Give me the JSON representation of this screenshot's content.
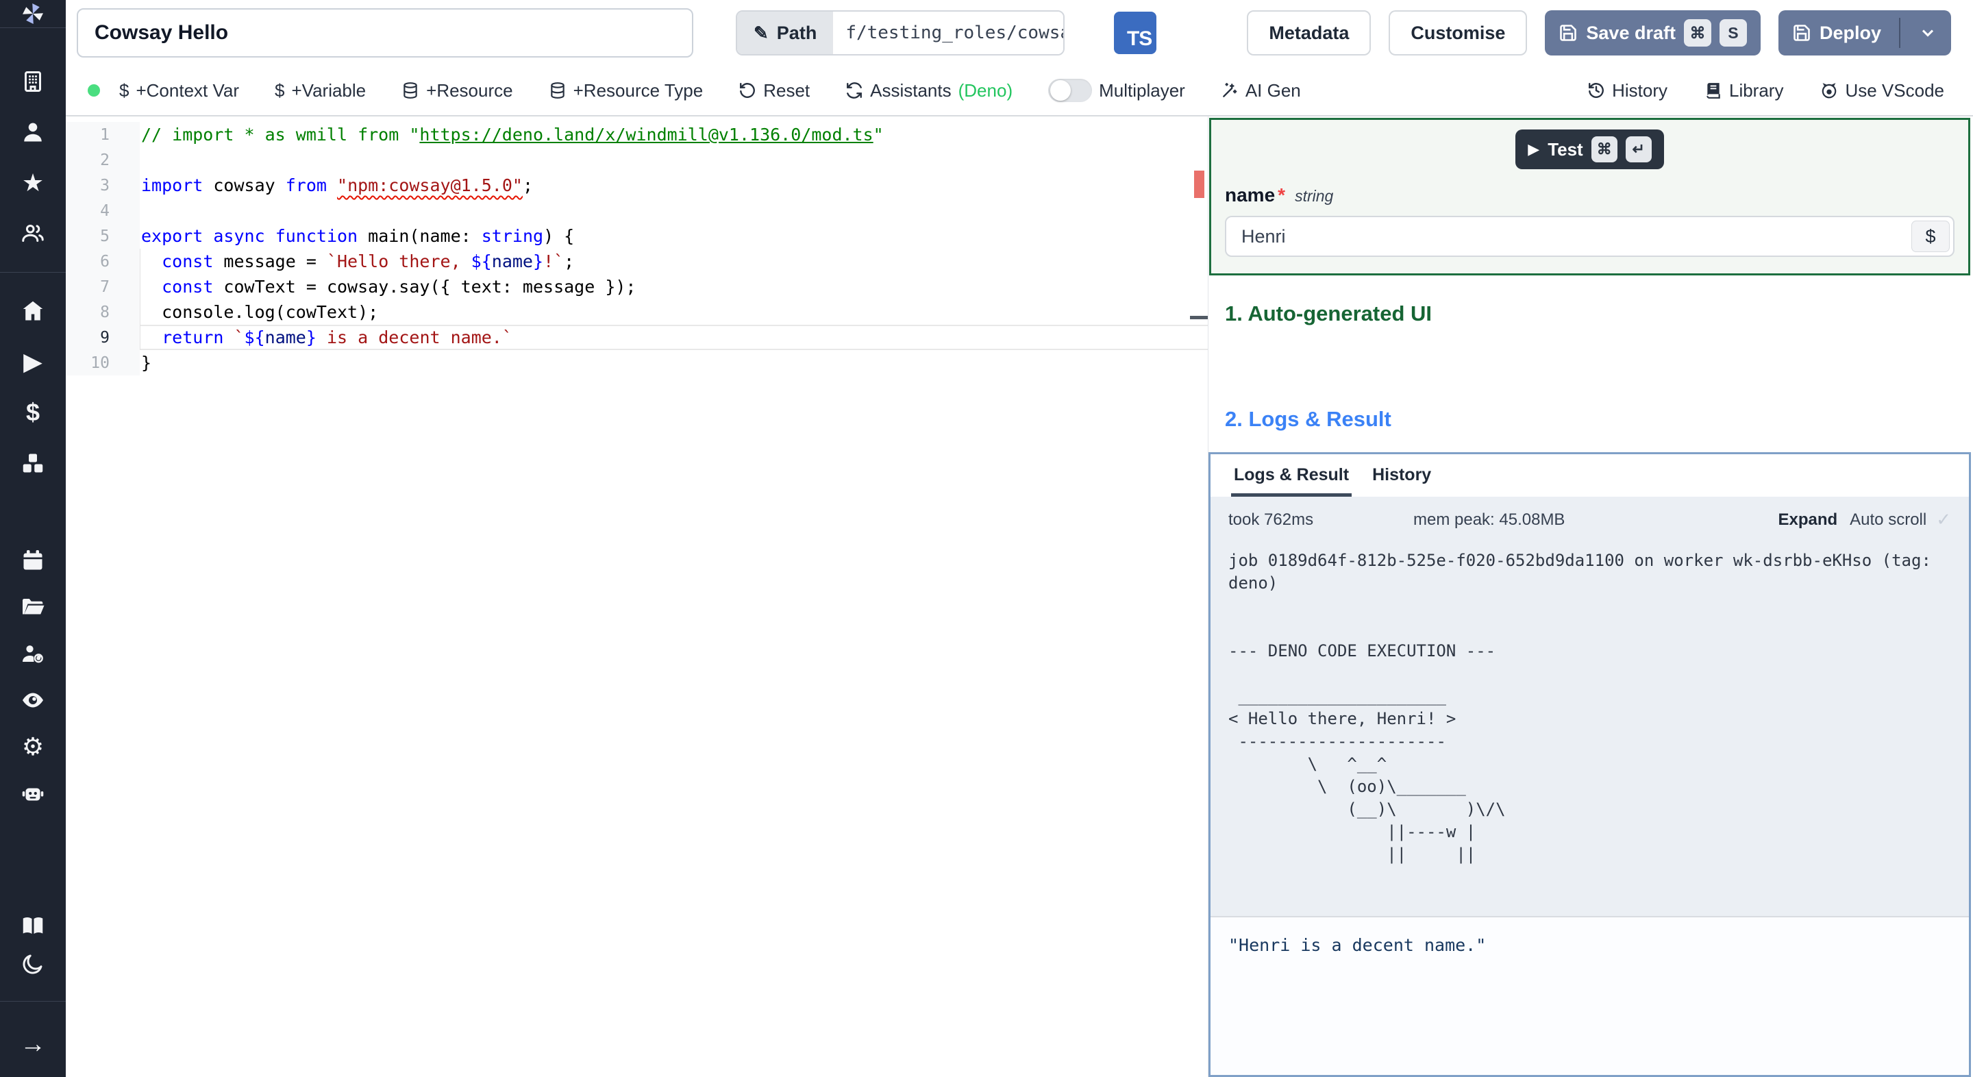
{
  "topbar": {
    "title_value": "Cowsay Hello",
    "path_label": "Path",
    "path_value": "f/testing_roles/cowsa",
    "lang_badge": "TS",
    "metadata_label": "Metadata",
    "customise_label": "Customise",
    "save_draft_label": "Save draft",
    "save_kbd_mod": "⌘",
    "save_kbd_key": "S",
    "deploy_label": "Deploy"
  },
  "toolbar": {
    "status_dot_color": "#4ade80",
    "context_var": "+Context Var",
    "variable": "+Variable",
    "resource": "+Resource",
    "resource_type": "+Resource Type",
    "reset": "Reset",
    "assistants": "Assistants",
    "assistants_lang": "(Deno)",
    "multiplayer": "Multiplayer",
    "ai_gen": "AI Gen",
    "history": "History",
    "library": "Library",
    "use_vscode": "Use VScode",
    "dollar": "$"
  },
  "sidebar": {
    "icons": [
      "windmill-logo",
      "building",
      "user",
      "star",
      "users",
      "home",
      "play",
      "dollar",
      "boxes",
      "calendar",
      "folder-open",
      "user-cog",
      "eye",
      "gear",
      "robot",
      "book-open",
      "moon",
      "arrow-right"
    ]
  },
  "editor": {
    "lines": [
      {
        "n": "1",
        "tokens": [
          [
            "c",
            "// import * as wmill from \""
          ],
          [
            "cl",
            "https://deno.land/x/windmill@v1.136.0/mod.ts"
          ],
          [
            "c",
            "\""
          ]
        ]
      },
      {
        "n": "2",
        "tokens": []
      },
      {
        "n": "3",
        "tokens": [
          [
            "k",
            "import"
          ],
          [
            "p",
            " cowsay "
          ],
          [
            "k",
            "from"
          ],
          [
            "p",
            " "
          ],
          [
            "sq",
            "\"npm:cowsay@1.5.0\""
          ],
          [
            "p",
            ";"
          ]
        ]
      },
      {
        "n": "4",
        "tokens": []
      },
      {
        "n": "5",
        "tokens": [
          [
            "k",
            "export"
          ],
          [
            "p",
            " "
          ],
          [
            "k",
            "async"
          ],
          [
            "p",
            " "
          ],
          [
            "k",
            "function"
          ],
          [
            "p",
            " main(name: "
          ],
          [
            "k",
            "string"
          ],
          [
            "p",
            ") {"
          ]
        ]
      },
      {
        "n": "6",
        "guide": true,
        "tokens": [
          [
            "p",
            "  "
          ],
          [
            "k",
            "const"
          ],
          [
            "p",
            " message = "
          ],
          [
            "s",
            "`Hello there, "
          ],
          [
            "b",
            "${"
          ],
          [
            "v",
            "name"
          ],
          [
            "b",
            "}"
          ],
          [
            "s",
            "!`"
          ],
          [
            "p",
            ";"
          ]
        ]
      },
      {
        "n": "7",
        "guide": true,
        "tokens": [
          [
            "p",
            "  "
          ],
          [
            "k",
            "const"
          ],
          [
            "p",
            " cowText = cowsay.say({ text: message });"
          ]
        ]
      },
      {
        "n": "8",
        "guide": true,
        "tokens": [
          [
            "p",
            "  console.log(cowText);"
          ]
        ]
      },
      {
        "n": "9",
        "guide": true,
        "active": true,
        "tokens": [
          [
            "p",
            "  "
          ],
          [
            "k",
            "return"
          ],
          [
            "p",
            " "
          ],
          [
            "s",
            "`"
          ],
          [
            "b",
            "${"
          ],
          [
            "v",
            "name"
          ],
          [
            "b",
            "}"
          ],
          [
            "s",
            " is a decent name.`"
          ]
        ]
      },
      {
        "n": "10",
        "tokens": [
          [
            "p",
            "}"
          ]
        ]
      }
    ]
  },
  "panel": {
    "test_label": "Test",
    "test_kbd_mod": "⌘",
    "test_kbd_enter": "↵",
    "arg_name": "name",
    "required_mark": "*",
    "arg_type": "string",
    "arg_value": "Henri",
    "dollar_button": "$",
    "section_auto_ui": "1. Auto-generated UI",
    "section_logs": "2. Logs & Result",
    "tab_logs": "Logs & Result",
    "tab_history": "History",
    "took": "took 762ms",
    "mem": "mem peak: 45.08MB",
    "expand": "Expand",
    "autoscroll": "Auto scroll",
    "check": "✓",
    "log_block": "job 0189d64f-812b-525e-f020-652bd9da1100 on worker wk-dsrbb-eKHso (tag: deno)\n\n\n--- DENO CODE EXECUTION ---\n\n _____________________\n< Hello there, Henri! >\n ---------------------\n        \\   ^__^\n         \\  (oo)\\_______\n            (__)\\       )\\/\\\n                ||----w |\n                ||     ||\n",
    "result": "\"Henri is a decent name.\""
  },
  "colors": {
    "accent_green_border": "#1d6f3f",
    "accent_blue_heading": "#3b82f6",
    "accent_green_heading": "#166534",
    "button_slate": "#67789a",
    "sidebar_bg": "#1e2430",
    "ts_badge": "#3b6cc0",
    "logs_border": "#7fa0c7"
  }
}
